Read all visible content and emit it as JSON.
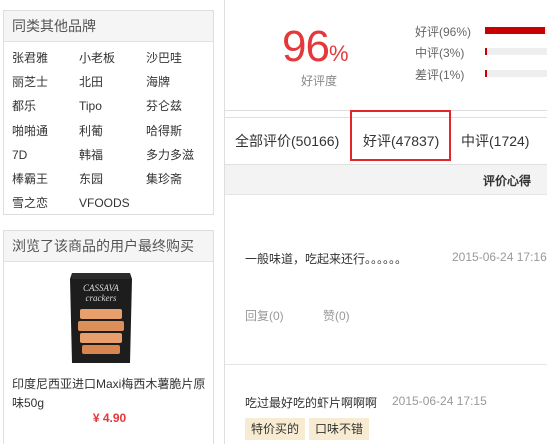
{
  "brands_panel": {
    "title": "同类其他品牌",
    "brands": [
      "张君雅",
      "小老板",
      "沙巴哇",
      "丽芝士",
      "北田",
      "海牌",
      "都乐",
      "Tipo",
      "芬仑兹",
      "啪啪通",
      "利葡",
      "哈得斯",
      "7D",
      "韩福",
      "多力多滋",
      "棒霸王",
      "东园",
      "集珍斋",
      "雪之恋",
      "VFOODS"
    ]
  },
  "related_panel": {
    "title": "浏览了该商品的用户最终购买",
    "product_title": "印度尼西亚进口Maxi梅西木薯脆片原味50g",
    "product_price": "¥ 4.90",
    "package_text_1": "CASSAVA",
    "package_text_2": "crackers"
  },
  "rating": {
    "percent": "96",
    "percent_sign": "%",
    "good_label": "好评度",
    "bars": [
      {
        "label": "好评(96%)",
        "value": 96
      },
      {
        "label": "中评(3%)",
        "value": 3
      },
      {
        "label": "差评(1%)",
        "value": 1
      }
    ],
    "colors": {
      "accent": "#e4393c",
      "bar": "#c80000"
    }
  },
  "tabs": [
    {
      "label": "全部评价(50166)"
    },
    {
      "label": "好评(47837)"
    },
    {
      "label": "中评(1724)"
    }
  ],
  "column_header": "评价心得",
  "reviews": [
    {
      "text": "一般味道，吃起来还行。。。。。。",
      "date": "2015-06-24 17:16",
      "reply": "回复(0)",
      "like": "赞(0)"
    },
    {
      "text": "吃过最好吃的虾片啊啊啊",
      "date": "2015-06-24 17:15",
      "tags": [
        "特价买的",
        "口味不错"
      ]
    }
  ]
}
